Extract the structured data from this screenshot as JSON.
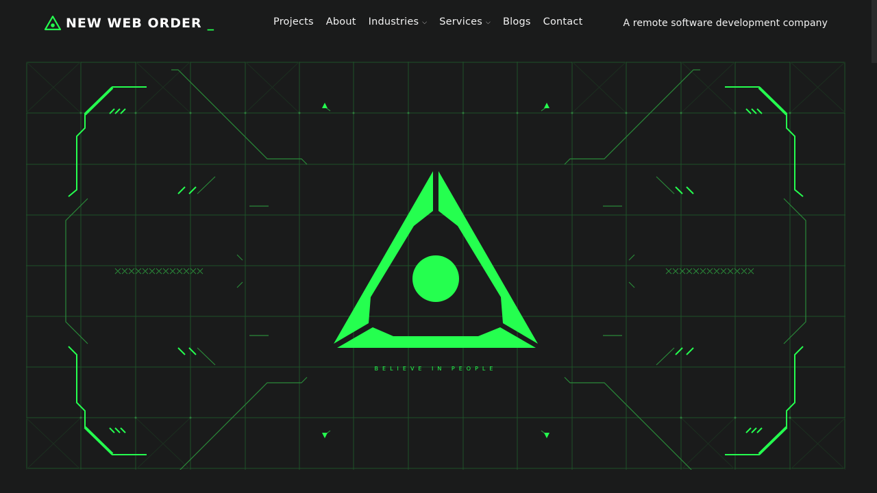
{
  "header": {
    "logo_text": "NEW WEB ORDER",
    "logo_cursor": "_",
    "logo_icon": "triangle-eye-icon",
    "nav": [
      {
        "label": "Projects",
        "has_dropdown": false
      },
      {
        "label": "About",
        "has_dropdown": false
      },
      {
        "label": "Industries",
        "has_dropdown": true
      },
      {
        "label": "Services",
        "has_dropdown": true
      },
      {
        "label": "Blogs",
        "has_dropdown": false
      },
      {
        "label": "Contact",
        "has_dropdown": false
      }
    ],
    "dropdown_icon": "chevron-down-icon",
    "tagline": "A remote software development company"
  },
  "hero": {
    "emblem_icon": "triangle-eye-icon",
    "motto": "BELIEVE IN PEOPLE"
  },
  "colors": {
    "background": "#1a1b1b",
    "accent": "#25ff4f",
    "grid": "#1f5a2a",
    "text": "#f2f2f2"
  }
}
